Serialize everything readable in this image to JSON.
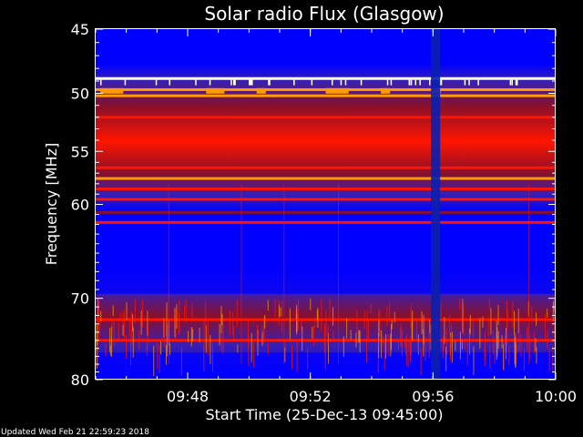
{
  "chart_data": {
    "type": "heatmap",
    "title": "Solar radio Flux (Glasgow)",
    "xlabel": "Start Time (25-Dec-13 09:45:00)",
    "ylabel": "Frequency [MHz]",
    "x_range": [
      "09:45:00",
      "10:00:00"
    ],
    "x_ticks": [
      "09:48",
      "09:52",
      "09:56",
      "10:00"
    ],
    "y_range": [
      45,
      80
    ],
    "y_ticks": [
      45,
      50,
      55,
      60,
      70,
      80
    ],
    "y_scale": "log",
    "colormap": [
      "#0000ff",
      "#3a1fb0",
      "#8a0f2a",
      "#ff1500",
      "#ff9a00",
      "#ffffe0"
    ],
    "background": "#000000",
    "strong_emission_bands_mhz": [
      48.8,
      49.7,
      50.2,
      52.0,
      54.0,
      56.5,
      57.5,
      58.5,
      59.5,
      60.8,
      61.8,
      72.5,
      75.0
    ],
    "quiet_bands_mhz": [
      [
        45.3,
        47.6
      ],
      [
        62.5,
        69.5
      ],
      [
        76.5,
        80.0
      ]
    ],
    "data_gap_time": "09:56:05"
  },
  "footer": {
    "updated": "Updated Wed Feb 21 22:59:23 2018"
  }
}
